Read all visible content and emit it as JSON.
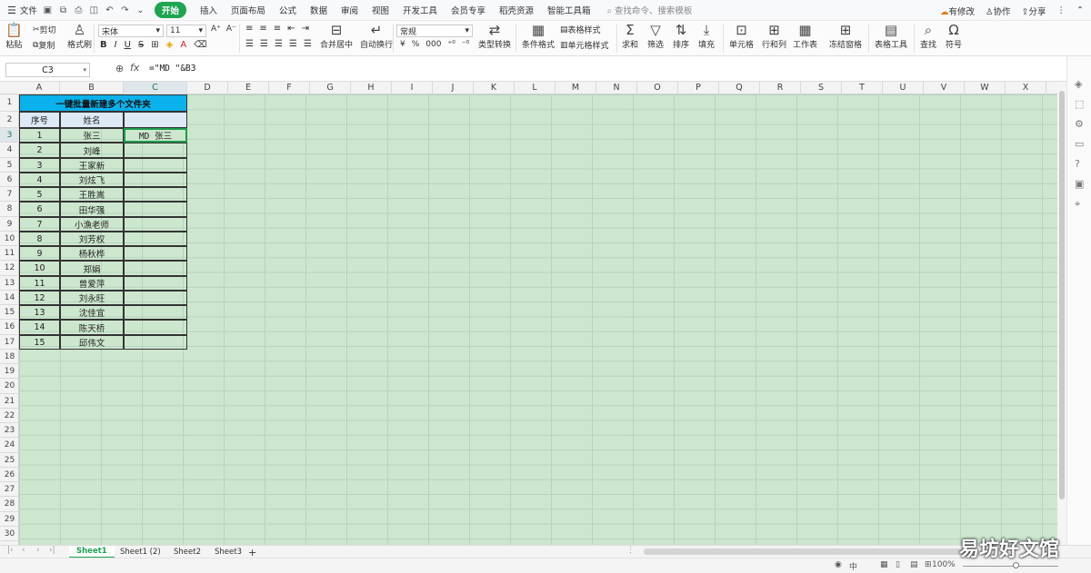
{
  "menu": {
    "file": "文件",
    "tabs": [
      "开始",
      "插入",
      "页面布局",
      "公式",
      "数据",
      "审阅",
      "视图",
      "开发工具",
      "会员专享",
      "稻壳资源",
      "智能工具箱"
    ],
    "search": "查找命令、搜索模板",
    "right": [
      "有修改",
      "协作",
      "分享"
    ]
  },
  "ribbon": {
    "paste": "粘贴",
    "cut": "剪切",
    "copy": "复制",
    "format_painter": "格式刷",
    "font_name": "宋体",
    "font_size": "11",
    "bold": "B",
    "italic": "I",
    "underline": "U",
    "strike": "S",
    "merge": "合并居中",
    "wrap": "自动换行",
    "number_format": "常规",
    "currency": "¥",
    "percent": "%",
    "thousand": "000",
    "type_convert": "类型转换",
    "cond_format": "条件格式",
    "table_style": "表格样式",
    "cell_style": "单元格样式",
    "sum": "求和",
    "filter": "筛选",
    "sort": "排序",
    "fill": "填充",
    "cell": "单元格",
    "row_col": "行和列",
    "worksheet": "工作表",
    "freeze": "冻结窗格",
    "table_tools": "表格工具",
    "find": "查找",
    "symbol": "符号"
  },
  "formula_bar": {
    "name_box": "C3",
    "fx": "fx",
    "formula": "=\"MD \"&B3"
  },
  "columns": [
    "A",
    "B",
    "C",
    "D",
    "E",
    "F",
    "G",
    "H",
    "I",
    "J",
    "K",
    "L",
    "M",
    "N",
    "O",
    "P",
    "Q",
    "R",
    "S",
    "T",
    "U",
    "V",
    "W",
    "X"
  ],
  "rows": [
    "1",
    "2",
    "3",
    "4",
    "5",
    "6",
    "7",
    "8",
    "9",
    "10",
    "11",
    "12",
    "13",
    "14",
    "15",
    "16",
    "17",
    "18",
    "19",
    "20",
    "21",
    "22",
    "23",
    "24",
    "25",
    "26",
    "27",
    "28",
    "29",
    "30"
  ],
  "sheet": {
    "title": "一键批量新建多个文件夹",
    "headers": [
      "序号",
      "姓名"
    ],
    "records": [
      [
        "1",
        "张三",
        "MD 张三"
      ],
      [
        "2",
        "刘峰",
        ""
      ],
      [
        "3",
        "王家新",
        ""
      ],
      [
        "4",
        "刘炫飞",
        ""
      ],
      [
        "5",
        "王胜嵩",
        ""
      ],
      [
        "6",
        "田华强",
        ""
      ],
      [
        "7",
        "小漁老师",
        ""
      ],
      [
        "8",
        "刘芳权",
        ""
      ],
      [
        "9",
        "杨秋桦",
        ""
      ],
      [
        "10",
        "郑娟",
        ""
      ],
      [
        "11",
        "曾爱萍",
        ""
      ],
      [
        "12",
        "刘永旺",
        ""
      ],
      [
        "13",
        "沈佳宜",
        ""
      ],
      [
        "14",
        "陈天桥",
        ""
      ],
      [
        "15",
        "邱伟文",
        ""
      ]
    ]
  },
  "sheet_tabs": [
    "Sheet1",
    "Sheet1 (2)",
    "Sheet2",
    "Sheet3"
  ],
  "status": {
    "zoom": "100%"
  },
  "watermark": "易坊好文馆"
}
